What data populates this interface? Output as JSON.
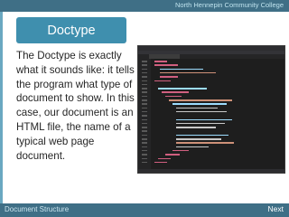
{
  "header": {
    "college": "North Hennepin Community College"
  },
  "title": "Doctype",
  "body_text": "The Doctype is exactly what it sounds like: it tells the program what type of document to show. In this case, our document is an HTML file, the name of a typical web page document.",
  "footer": {
    "section": "Document Structure",
    "next_label": "Next"
  },
  "colors": {
    "accent": "#3f6f86",
    "title_fill": "#3f8fae",
    "text": "#262626",
    "editor_bg": "#1e1e1e"
  }
}
